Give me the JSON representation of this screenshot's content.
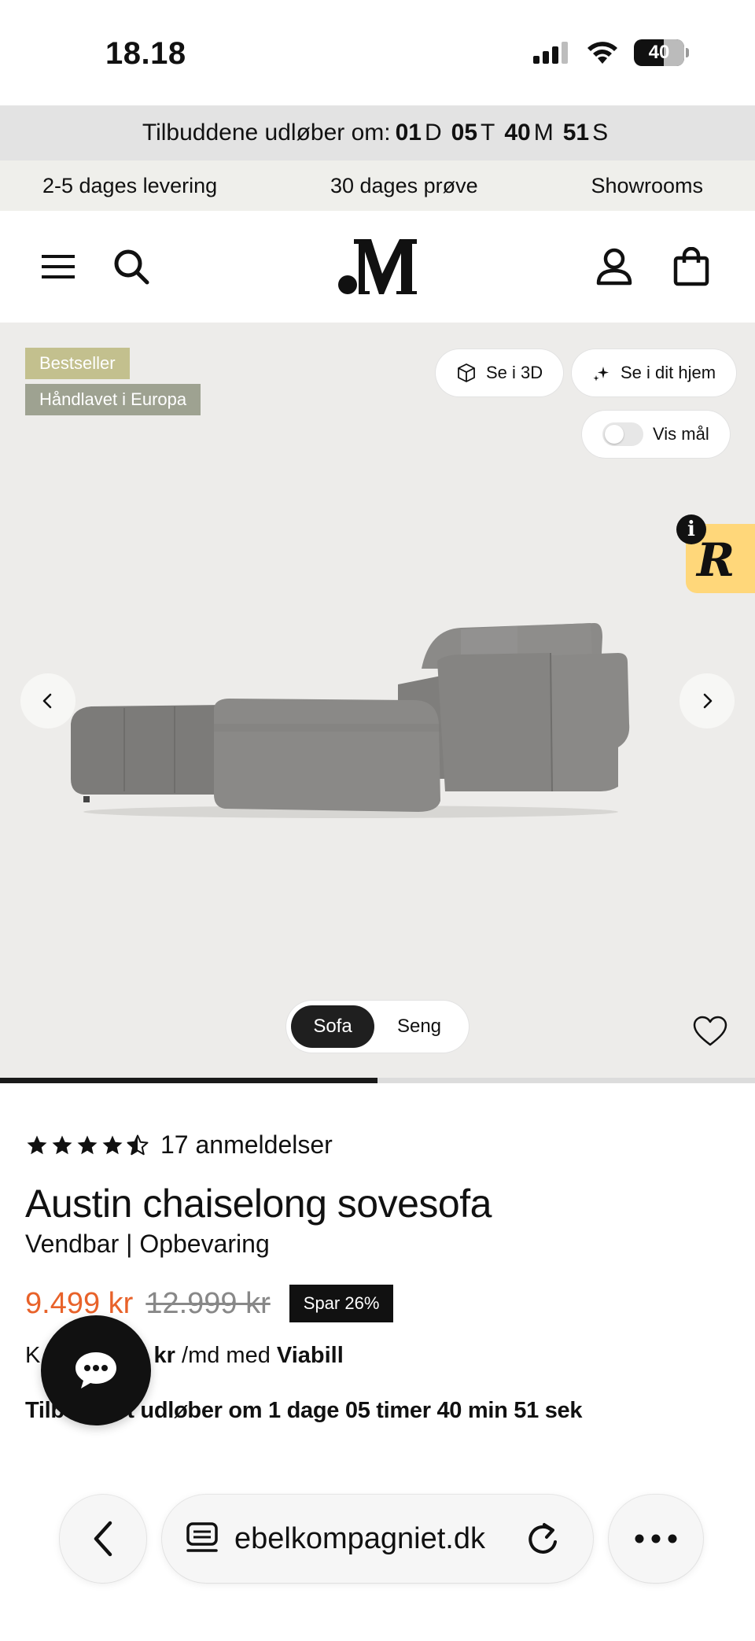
{
  "status_bar": {
    "time": "18.18",
    "battery": "40"
  },
  "countdown": {
    "label": "Tilbuddene udløber om:",
    "days": "01",
    "days_unit": "D",
    "hours": "05",
    "hours_unit": "T",
    "minutes": "40",
    "minutes_unit": "M",
    "seconds": "51",
    "seconds_unit": "S"
  },
  "usp": {
    "delivery": "2-5 dages levering",
    "trial": "30 dages prøve",
    "showrooms": "Showrooms"
  },
  "header": {
    "icons": [
      "menu-icon",
      "search-icon",
      "account-icon",
      "cart-icon"
    ]
  },
  "gallery": {
    "badge_bestseller": "Bestseller",
    "badge_handmade": "Håndlavet i Europa",
    "view_3d": "Se i 3D",
    "view_home": "Se i dit hjem",
    "show_measures": "Vis mål",
    "show_measures_on": false,
    "variant_options": [
      "Sofa",
      "Seng"
    ],
    "variant_selected": "Sofa",
    "slide_progress": 0.5
  },
  "product": {
    "rating": 4.5,
    "review_count": "17 anmeldelser",
    "title": "Austin chaiselong sovesofa",
    "subtitle": "Vendbar | Opbevaring",
    "price_current": "9.499 kr",
    "price_old": "12.999 kr",
    "save_badge": "Spar 26%",
    "installment_prefix": "K",
    "installment_amount": "5 kr",
    "installment_suffix": " /md med ",
    "installment_provider": "Viabill",
    "offer_line": "Tilbu        t udløber om 1 dage 05 timer 40 min 51 sek"
  },
  "browser": {
    "url": "ebelkompagniet.dk"
  },
  "colors": {
    "price_accent": "#e8622a",
    "badge_bestseller": "#c3c08e",
    "badge_handmade": "#9ea291",
    "review_widget": "#ffd77a"
  }
}
